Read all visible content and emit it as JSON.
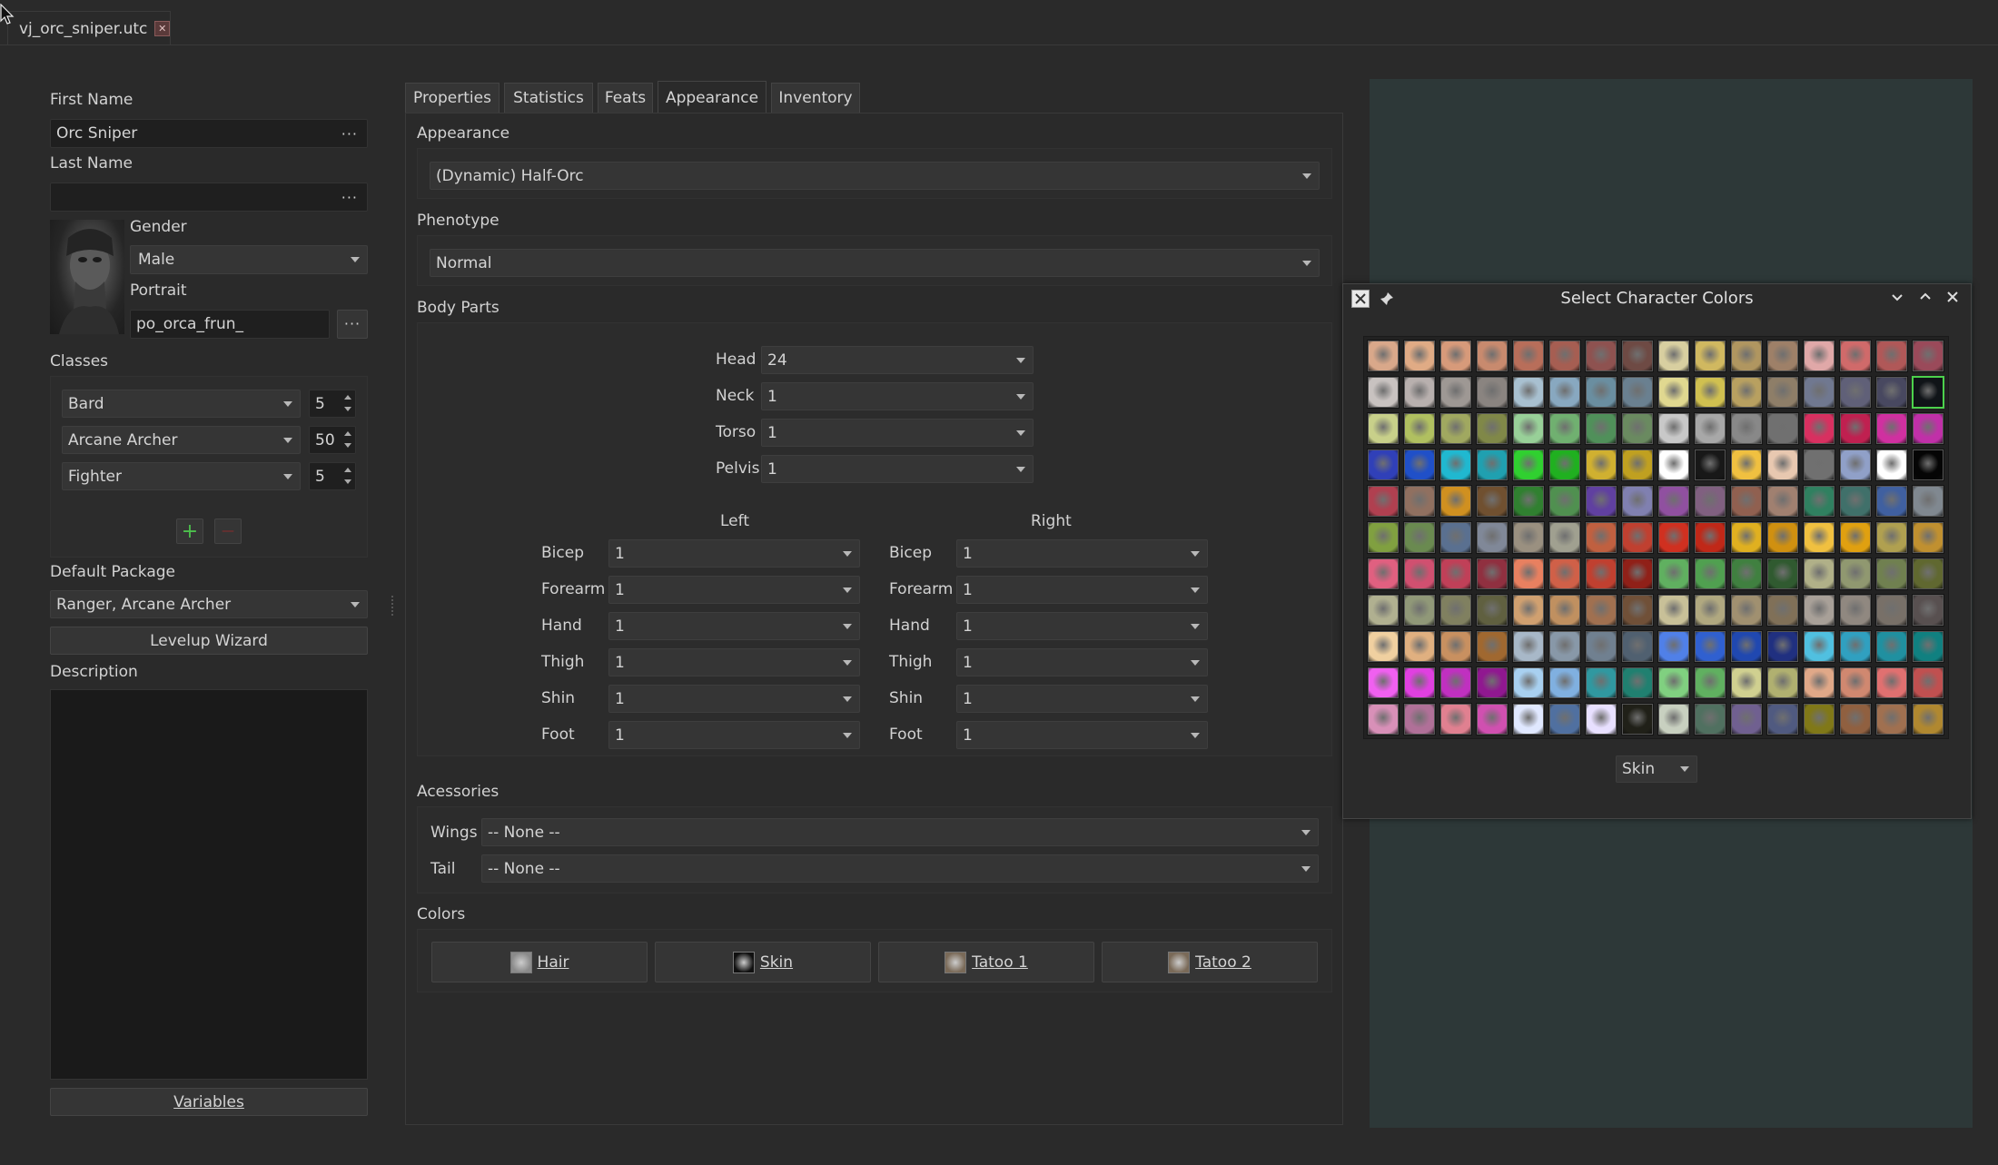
{
  "file_tab": {
    "name": "vj_orc_sniper.utc",
    "close": "✕"
  },
  "left": {
    "first_name_label": "First Name",
    "first_name_value": "Orc Sniper",
    "last_name_label": "Last Name",
    "last_name_value": "",
    "dots": "···",
    "gender_label": "Gender",
    "gender_value": "Male",
    "portrait_label": "Portrait",
    "portrait_value": "po_orca_frun_",
    "classes_label": "Classes",
    "classes": [
      {
        "name": "Bard",
        "level": "5"
      },
      {
        "name": "Arcane Archer",
        "level": "50"
      },
      {
        "name": "Fighter",
        "level": "5"
      }
    ],
    "add": "+",
    "remove": "—",
    "default_package_label": "Default Package",
    "default_package_value": "Ranger, Arcane Archer",
    "levelup_label": "Levelup Wizard",
    "description_label": "Description",
    "variables_label": "Variables"
  },
  "tabs": [
    {
      "label": "Properties"
    },
    {
      "label": "Statistics"
    },
    {
      "label": "Feats"
    },
    {
      "label": "Appearance"
    },
    {
      "label": "Inventory"
    }
  ],
  "appearance": {
    "appearance_label": "Appearance",
    "appearance_value": "(Dynamic) Half-Orc",
    "phenotype_label": "Phenotype",
    "phenotype_value": "Normal",
    "body_parts_label": "Body Parts",
    "top_parts": [
      {
        "label": "Head",
        "value": "24"
      },
      {
        "label": "Neck",
        "value": "1"
      },
      {
        "label": "Torso",
        "value": "1"
      },
      {
        "label": "Pelvis",
        "value": "1"
      }
    ],
    "left_label": "Left",
    "right_label": "Right",
    "limbs": [
      {
        "label": "Bicep",
        "left": "1",
        "right": "1"
      },
      {
        "label": "Forearm",
        "left": "1",
        "right": "1"
      },
      {
        "label": "Hand",
        "left": "1",
        "right": "1"
      },
      {
        "label": "Thigh",
        "left": "1",
        "right": "1"
      },
      {
        "label": "Shin",
        "left": "1",
        "right": "1"
      },
      {
        "label": "Foot",
        "left": "1",
        "right": "1"
      }
    ],
    "accessories_label": "Acessories",
    "wings_label": "Wings",
    "wings_value": "-- None --",
    "tail_label": "Tail",
    "tail_value": "-- None --",
    "colors_label": "Colors",
    "color_buttons": [
      {
        "label": "Hair",
        "swatch": "#8a8a8a"
      },
      {
        "label": "Skin",
        "swatch": "#101010"
      },
      {
        "label": "Tatoo 1",
        "swatch": "#7a6a58"
      },
      {
        "label": "Tatoo 2",
        "swatch": "#7a6a58"
      }
    ]
  },
  "dialog": {
    "title": "Select Character Colors",
    "channel_value": "Skin",
    "selected_swatch": {
      "row": 1,
      "col": 15
    },
    "rows": [
      [
        "#d9a88a",
        "#e0ab85",
        "#d79a7a",
        "#c88a6e",
        "#b86e5a",
        "#a65e52",
        "#8e5250",
        "#6e4a44",
        "#d8cfa0",
        "#d0b860",
        "#b09660",
        "#9e8068",
        "#e0a8a8",
        "#d06a6a",
        "#b05858",
        "#9a4a5a"
      ],
      [
        "#c8c2c0",
        "#b8b0ae",
        "#9e9894",
        "#8a8480",
        "#a8c0d0",
        "#88a8c0",
        "#6a8ea0",
        "#6a8090",
        "#e0d890",
        "#d0c050",
        "#b8a060",
        "#8e7e68",
        "#707890",
        "#606078",
        "#484860",
        "#101418"
      ],
      [
        "#c8d08a",
        "#b0c060",
        "#a0a860",
        "#808848",
        "#98d098",
        "#70b070",
        "#50905a",
        "#6a8a60",
        "#c8c8c8",
        "#a8a8a8",
        "#888888",
        "#707070",
        "#d83060",
        "#c02050",
        "#d030a0",
        "#c030a8"
      ],
      [
        "#3040b8",
        "#2050c8",
        "#20b8d0",
        "#20a0b0",
        "#30d030",
        "#20b020",
        "#d0b030",
        "#c0a020",
        "#ffffff",
        "#181818",
        "#f0c040",
        "#e8c8b0",
        "#707070",
        "#90a0c8",
        "#ffffff",
        "#050505"
      ],
      [
        "#b04050",
        "#907060",
        "#d09020",
        "#705030",
        "#308030",
        "#509050",
        "#6040a0",
        "#8080b0",
        "#9050a0",
        "#806080",
        "#906050",
        "#a08070",
        "#308060",
        "#40706a",
        "#4060a0",
        "#808890"
      ],
      [
        "#80a040",
        "#6a8a50",
        "#5a7090",
        "#808898",
        "#9a9080",
        "#a0a090",
        "#c06040",
        "#c04030",
        "#d03020",
        "#c02818",
        "#e0b020",
        "#d09010",
        "#f0c040",
        "#e0a010",
        "#b0a050",
        "#c09030"
      ],
      [
        "#e06080",
        "#d05070",
        "#c04058",
        "#903040",
        "#e88060",
        "#d06048",
        "#c04030",
        "#902018",
        "#60b060",
        "#50a050",
        "#408040",
        "#305a30",
        "#b0b088",
        "#909870",
        "#708050",
        "#606830"
      ],
      [
        "#b0b090",
        "#909878",
        "#808060",
        "#606040",
        "#d0a070",
        "#c09060",
        "#a07050",
        "#705038",
        "#c8c098",
        "#b0a880",
        "#a09070",
        "#807058",
        "#a8a098",
        "#908880",
        "#787068",
        "#585050"
      ],
      [
        "#f0d0a0",
        "#e0b080",
        "#c89060",
        "#a06830",
        "#a8b8c8",
        "#8898a8",
        "#708090",
        "#506070",
        "#5080e8",
        "#3060d0",
        "#2048b0",
        "#203080",
        "#50c0e0",
        "#30a0c0",
        "#2090a0",
        "#108080"
      ],
      [
        "#f060f0",
        "#e040e0",
        "#c030c0",
        "#901890",
        "#a8d0f0",
        "#80b0e0",
        "#3098a0",
        "#208070",
        "#80d080",
        "#60b060",
        "#d0d090",
        "#b0b070",
        "#e0a888",
        "#d08870",
        "#e07070",
        "#c05050"
      ],
      [
        "#d890b8",
        "#b07098",
        "#e08090",
        "#d050b0",
        "#e0e8ff",
        "#5070a0",
        "#e8e0ff",
        "#202018",
        "#c8d0c0",
        "#507060",
        "#706090",
        "#505a80",
        "#807818",
        "#906040",
        "#a07050",
        "#b08830"
      ]
    ]
  }
}
